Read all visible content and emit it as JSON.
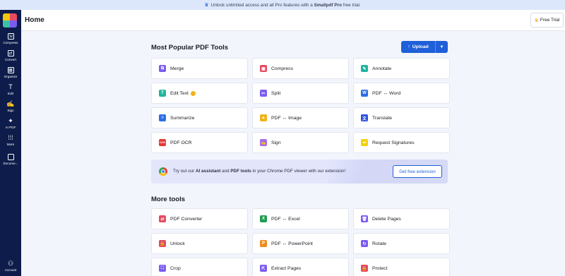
{
  "banner": {
    "prefix": "Unlock unlimited access and all Pro features with a",
    "brand": "Smallpdf Pro",
    "suffix": "free trial."
  },
  "sidebar": {
    "items": [
      {
        "label": "Compress",
        "icon": "compress-icon"
      },
      {
        "label": "Convert",
        "icon": "convert-icon"
      },
      {
        "label": "Organize",
        "icon": "organize-icon"
      },
      {
        "label": "Edit",
        "icon": "edit-text-icon"
      },
      {
        "label": "Sign",
        "icon": "sign-icon"
      },
      {
        "label": "AI PDF",
        "icon": "ai-sparkle-icon"
      },
      {
        "label": "More",
        "icon": "grid-icon"
      },
      {
        "label": "Docume...",
        "icon": "folder-icon"
      },
      {
        "label": "Account",
        "icon": "user-icon"
      }
    ]
  },
  "header": {
    "title": "Home",
    "free_trial": "Free Trial"
  },
  "popular": {
    "title": "Most Popular PDF Tools",
    "upload_label": "Upload",
    "tools": [
      {
        "label": "Merge",
        "color": "#7b5cf0",
        "glyph": "⧉"
      },
      {
        "label": "Compress",
        "color": "#e84a5f",
        "glyph": "▣"
      },
      {
        "label": "Annotate",
        "color": "#1fb5a0",
        "glyph": "✎"
      },
      {
        "label": "Edit Text",
        "color": "#1fb5a0",
        "glyph": "T",
        "pro": true
      },
      {
        "label": "Split",
        "color": "#7b5cf0",
        "glyph": "✂"
      },
      {
        "label": "PDF ↔ Word",
        "color": "#2b6ee6",
        "glyph": "W"
      },
      {
        "label": "Summarize",
        "color": "#2b6ee6",
        "glyph": "≡"
      },
      {
        "label": "PDF ↔ Image",
        "color": "#f0b41a",
        "glyph": "▲"
      },
      {
        "label": "Translate",
        "color": "#2b4fd9",
        "glyph": "文"
      },
      {
        "label": "PDF OCR",
        "color": "#e53935",
        "glyph": "OCR"
      },
      {
        "label": "Sign",
        "color": "#a66be8",
        "glyph": "✍"
      },
      {
        "label": "Request Signatures",
        "color": "#f5d00f",
        "glyph": "✒"
      }
    ]
  },
  "promo": {
    "pre": "Try out our",
    "ai": "AI assistant",
    "and": "and",
    "tools": "PDF tools",
    "post": "in your Chrome PDF viewer with our extension!",
    "button": "Get free extension"
  },
  "more": {
    "title": "More tools",
    "tools": [
      {
        "label": "PDF Converter",
        "color": "#e84a5f",
        "glyph": "⇄"
      },
      {
        "label": "PDF ↔ Excel",
        "color": "#1e9d52",
        "glyph": "X"
      },
      {
        "label": "Delete Pages",
        "color": "#7b5cf0",
        "glyph": "🗑"
      },
      {
        "label": "Unlock",
        "color": "#e84a5f",
        "glyph": "🔓"
      },
      {
        "label": "PDF ↔ PowerPoint",
        "color": "#f08c1a",
        "glyph": "P"
      },
      {
        "label": "Rotate",
        "color": "#7b5cf0",
        "glyph": "↻"
      },
      {
        "label": "Crop",
        "color": "#7b5cf0",
        "glyph": "⛶"
      },
      {
        "label": "Extract Pages",
        "color": "#7b5cf0",
        "glyph": "⇱"
      },
      {
        "label": "Protect",
        "color": "#e84a5f",
        "glyph": "🔒"
      }
    ]
  }
}
